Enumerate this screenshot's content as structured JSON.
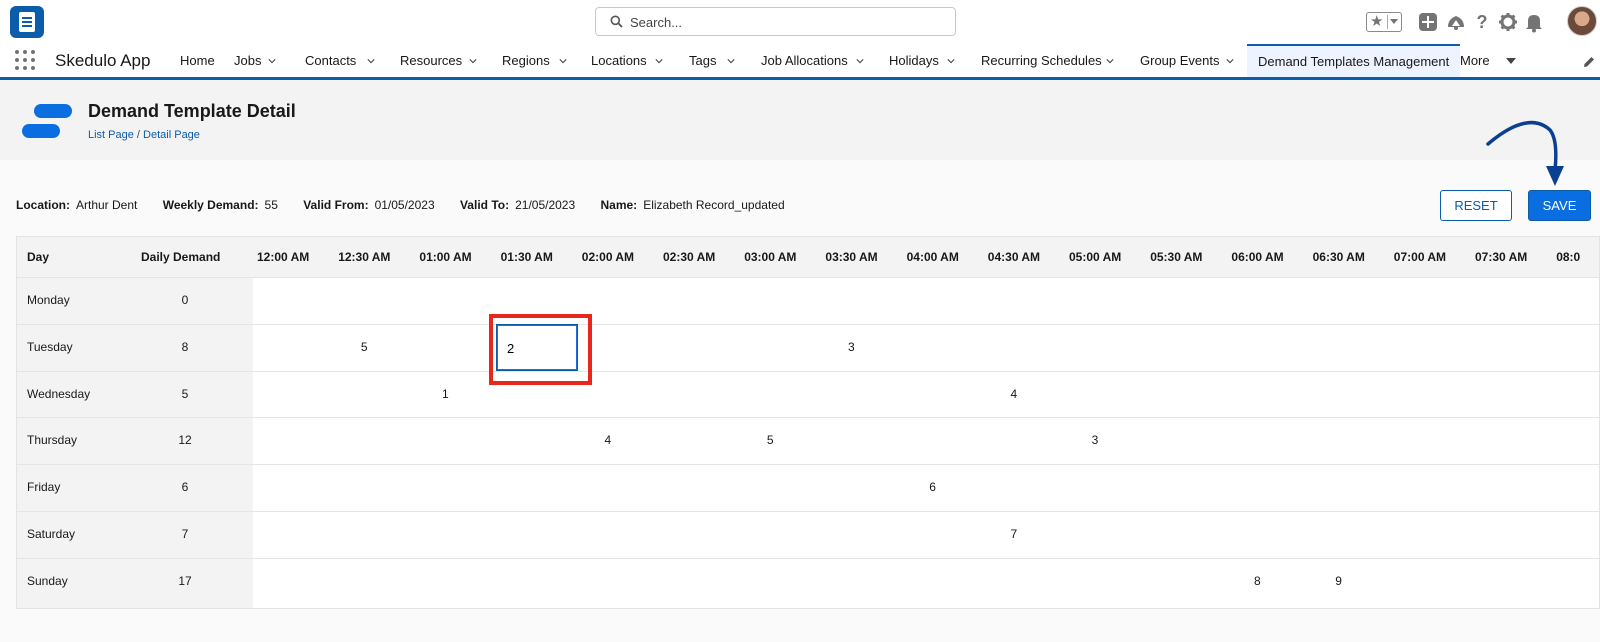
{
  "header": {
    "search_placeholder": "Search...",
    "icons": [
      "star-icon",
      "add-icon",
      "trailhead-icon",
      "help-icon",
      "gear-icon",
      "bell-icon"
    ]
  },
  "nav": {
    "app_name": "Skedulo App",
    "tabs": [
      {
        "label": "Home",
        "dropdown": false
      },
      {
        "label": "Jobs",
        "dropdown": true
      },
      {
        "label": "Contacts",
        "dropdown": true
      },
      {
        "label": "Resources",
        "dropdown": true
      },
      {
        "label": "Regions",
        "dropdown": true
      },
      {
        "label": "Locations",
        "dropdown": true
      },
      {
        "label": "Tags",
        "dropdown": true
      },
      {
        "label": "Job Allocations",
        "dropdown": true
      },
      {
        "label": "Holidays",
        "dropdown": true
      },
      {
        "label": "Recurring Schedules",
        "dropdown": true
      },
      {
        "label": "Group Events",
        "dropdown": true
      },
      {
        "label": "Demand Templates Management",
        "dropdown": false,
        "active": true
      },
      {
        "label": "More",
        "dropdown": true
      }
    ]
  },
  "page": {
    "title": "Demand Template Detail",
    "breadcrumb_list": "List Page",
    "breadcrumb_sep": " / ",
    "breadcrumb_detail": "Detail Page"
  },
  "info": {
    "location_label": "Location:",
    "location": "Arthur Dent",
    "weekly_label": "Weekly Demand:",
    "weekly": "55",
    "valid_from_label": "Valid From:",
    "valid_from": "01/05/2023",
    "valid_to_label": "Valid To:",
    "valid_to": "21/05/2023",
    "name_label": "Name:",
    "name": "Elizabeth Record_updated"
  },
  "actions": {
    "reset": "RESET",
    "save": "SAVE"
  },
  "grid": {
    "col_day": "Day",
    "col_daily": "Daily Demand",
    "times": [
      "12:00 AM",
      "12:30 AM",
      "01:00 AM",
      "01:30 AM",
      "02:00 AM",
      "02:30 AM",
      "03:00 AM",
      "03:30 AM",
      "04:00 AM",
      "04:30 AM",
      "05:00 AM",
      "05:30 AM",
      "06:00 AM",
      "06:30 AM",
      "07:00 AM",
      "07:30 AM",
      "08:0"
    ],
    "rows": [
      {
        "day": "Monday",
        "daily": "0",
        "cells": {}
      },
      {
        "day": "Tuesday",
        "daily": "8",
        "cells": {
          "1": "5",
          "7": "3"
        },
        "editing": {
          "col": 3,
          "value": "2"
        }
      },
      {
        "day": "Wednesday",
        "daily": "5",
        "cells": {
          "2": "1",
          "9": "4"
        }
      },
      {
        "day": "Thursday",
        "daily": "12",
        "cells": {
          "4": "4",
          "6": "5",
          "10": "3"
        }
      },
      {
        "day": "Friday",
        "daily": "6",
        "cells": {
          "8": "6"
        }
      },
      {
        "day": "Saturday",
        "daily": "7",
        "cells": {
          "9": "7"
        }
      },
      {
        "day": "Sunday",
        "daily": "17",
        "cells": {
          "12": "8",
          "13": "9"
        }
      }
    ]
  }
}
